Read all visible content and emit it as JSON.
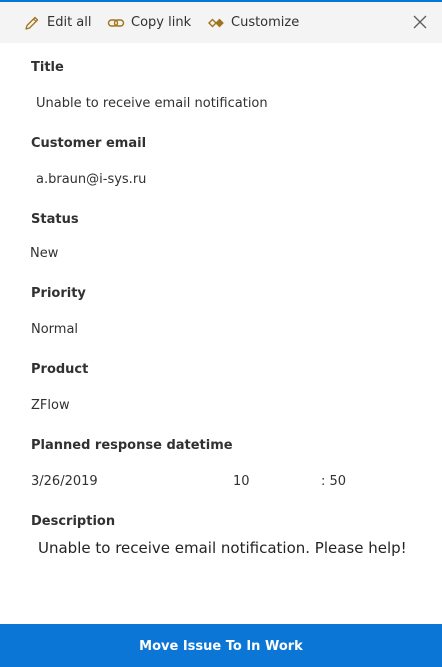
{
  "toolbar": {
    "edit_all_label": "Edit all",
    "copy_link_label": "Copy link",
    "customize_label": "Customize"
  },
  "fields": {
    "title": {
      "label": "Title",
      "value": "Unable to receive email notification"
    },
    "customer_email": {
      "label": "Customer email",
      "value": "a.braun@i-sys.ru"
    },
    "status": {
      "label": "Status",
      "value": "New"
    },
    "priority": {
      "label": "Priority",
      "value": "Normal"
    },
    "product": {
      "label": "Product",
      "value": "ZFlow"
    },
    "planned_response": {
      "label": "Planned response datetime",
      "date": "3/26/2019",
      "hour": "10",
      "minute": ": 50"
    },
    "description": {
      "label": "Description",
      "value": "Unable to receive email notification. Please help!"
    }
  },
  "footer": {
    "action_label": "Move Issue To In Work"
  },
  "colors": {
    "accent": "#0b76d6",
    "toolbar_bg": "#f4f4f4",
    "icon_gold": "#a0741d"
  }
}
